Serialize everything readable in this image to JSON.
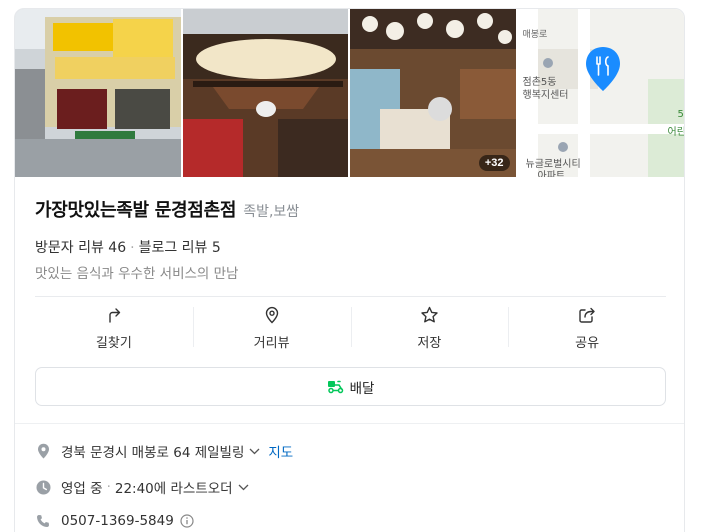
{
  "photos": {
    "more_count": "+32",
    "map_labels": [
      "매봉로",
      "점촌5동",
      "행복지센터",
      "뉴글로벌시티",
      "아파트",
      "5",
      "어린"
    ]
  },
  "place": {
    "name": "가장맛있는족발 문경점촌점",
    "category": "족발,보쌈",
    "visitor_reviews": "방문자 리뷰 46",
    "blog_reviews": "블로그 리뷰 5",
    "description": "맛있는 음식과 우수한 서비스의 만남"
  },
  "actions": {
    "directions": "길찾기",
    "street_view": "거리뷰",
    "save": "저장",
    "share": "공유"
  },
  "delivery": {
    "label": "배달"
  },
  "details": {
    "address": "경북 문경시 매봉로 64 제일빌링",
    "map_link": "지도",
    "status": "영업 중",
    "last_order": "22:40에 라스트오더",
    "phone": "0507-1369-5849"
  },
  "colors": {
    "accent_blue": "#0068c3",
    "map_pin": "#1a8cff",
    "delivery_green": "#03c75a"
  }
}
